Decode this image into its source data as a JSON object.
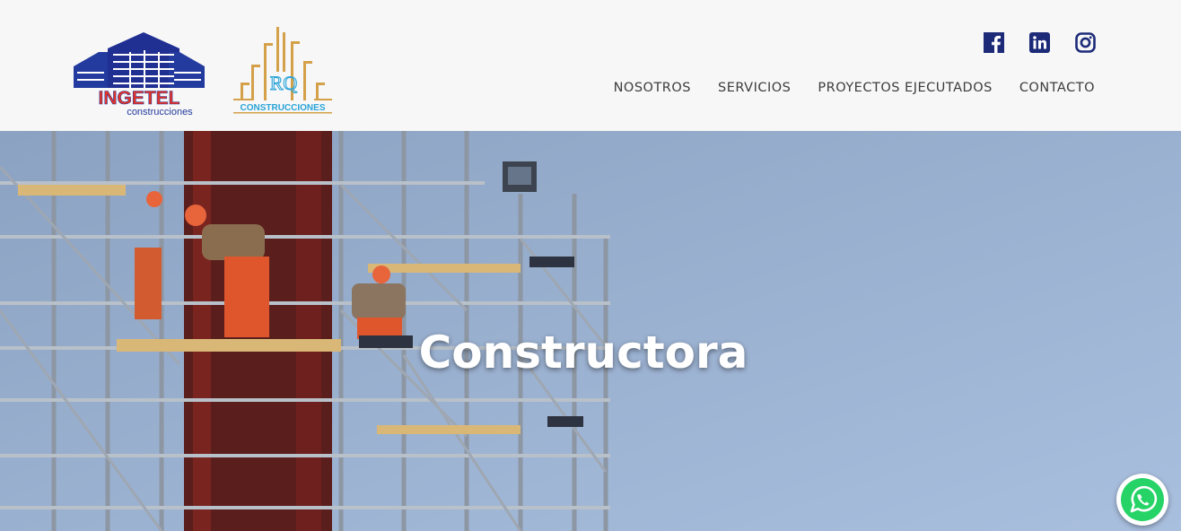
{
  "brand": {
    "logo1_name": "INGETEL",
    "logo1_sub": "construcciones",
    "logo2_text": "CONSTRUCCIONES",
    "logo2_mark": "RQ"
  },
  "social": [
    {
      "name": "facebook-icon"
    },
    {
      "name": "linkedin-icon"
    },
    {
      "name": "instagram-icon"
    }
  ],
  "nav": {
    "items": [
      "NOSOTROS",
      "SERVICIOS",
      "PROYECTOS EJECUTADOS",
      "CONTACTO"
    ]
  },
  "hero": {
    "title": "Constructora"
  },
  "colors": {
    "logo_blue": "#233a9e",
    "logo_red": "#e53327",
    "logo_gold": "#d4a14a",
    "logo_cyan": "#2aa4d8",
    "whatsapp_green": "#25d366",
    "header_bg": "#f7f7f7"
  }
}
